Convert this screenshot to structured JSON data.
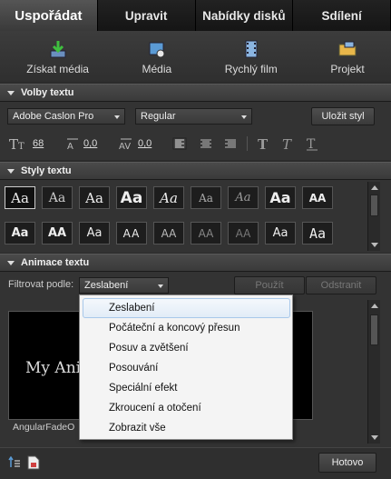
{
  "tabs": [
    {
      "label": "Uspořádat",
      "active": true
    },
    {
      "label": "Upravit",
      "active": false
    },
    {
      "label": "Nabídky disků",
      "active": false
    },
    {
      "label": "Sdílení",
      "active": false
    }
  ],
  "toolbar": [
    {
      "label": "Získat média",
      "icon": "download-media-icon"
    },
    {
      "label": "Média",
      "icon": "media-icon"
    },
    {
      "label": "Rychlý film",
      "icon": "film-icon"
    },
    {
      "label": "Projekt",
      "icon": "project-folder-icon"
    }
  ],
  "text_options": {
    "header": "Volby textu",
    "font_family": "Adobe Caslon Pro",
    "font_style": "Regular",
    "save_style_label": "Uložit styl",
    "font_size": "68",
    "leading": "0,0",
    "kerning": "0,0"
  },
  "text_styles": {
    "header": "Styly textu",
    "row1": [
      "Aa",
      "Aa",
      "Aa",
      "Aa",
      "Aa",
      "Aa",
      "Aa",
      "Aa",
      "AA"
    ],
    "row2": [
      "Aa",
      "AA",
      "Aa",
      "AA",
      "AA",
      "AA",
      "AA",
      "Aa",
      "Aa"
    ]
  },
  "text_animation": {
    "header": "Animace textu",
    "filter_label": "Filtrovat podle:",
    "filter_value": "Zeslabení",
    "apply_label": "Použít",
    "remove_label": "Odstranit",
    "preview_text": "My Anim",
    "preview_caption": "AngularFadeO",
    "menu_items": [
      "Zeslabení",
      "Počáteční a koncový přesun",
      "Posuv a zvětšení",
      "Posouvání",
      "Speciální efekt",
      "Zkroucení a otočení",
      "Zobrazit vše"
    ]
  },
  "bottom": {
    "done_label": "Hotovo"
  },
  "colors": {
    "background": "#2b2b2b",
    "menu_background": "#f4f4f4",
    "menu_highlight": "#e2ecf7"
  }
}
